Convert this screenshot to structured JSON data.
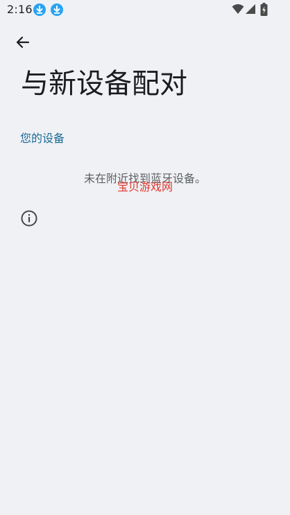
{
  "status_bar": {
    "time": "2:16",
    "notification_icons": [
      "download-icon",
      "download-icon"
    ],
    "system_icons": [
      "wifi-icon",
      "cellular-signal-icon",
      "battery-charging-icon"
    ],
    "accent_color": "#2aa3f0"
  },
  "header": {
    "back_icon": "arrow-left-icon",
    "title": "与新设备配对"
  },
  "section": {
    "title": "您的设备",
    "title_color": "#1a6a95"
  },
  "empty_state": {
    "message": "未在附近找到蓝牙设备。"
  },
  "watermark": {
    "text": "宝贝游戏网",
    "color": "#e0382e"
  },
  "footer": {
    "info_icon": "info-icon"
  }
}
